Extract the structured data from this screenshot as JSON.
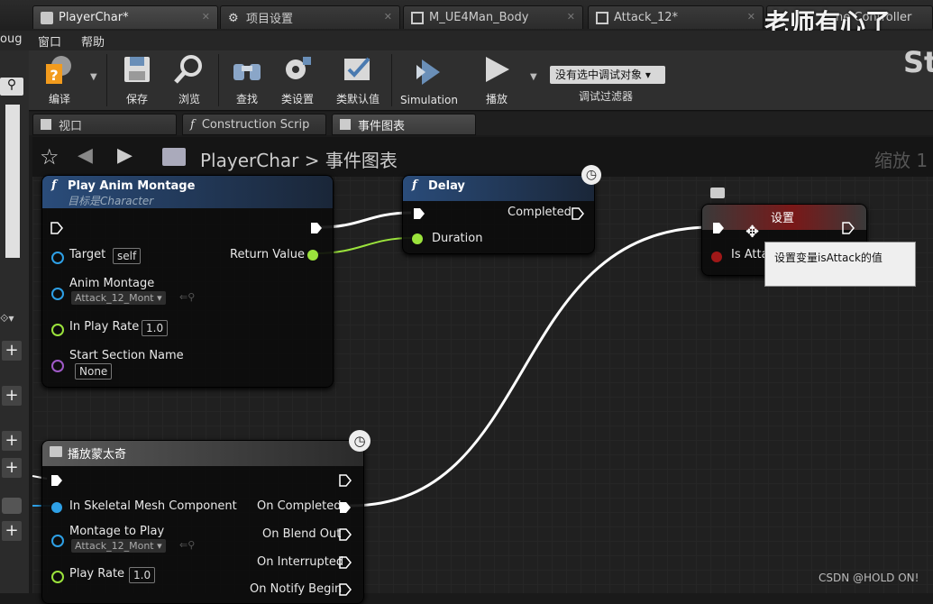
{
  "tabs": [
    {
      "label": "PlayerChar*",
      "active": true
    },
    {
      "label": "项目设置",
      "active": false
    },
    {
      "label": "M_UE4Man_Body",
      "active": false
    },
    {
      "label": "Attack_12*",
      "active": false
    },
    {
      "label": "ne Controller",
      "active": false
    }
  ],
  "watermark": "老师有心了",
  "menu": {
    "debug": "oug",
    "window": "窗口",
    "help": "帮助"
  },
  "toolbar": {
    "compile": "编译",
    "save": "保存",
    "browse": "浏览",
    "find": "查找",
    "class_settings": "类设置",
    "class_defaults": "类默认值",
    "simulation": "Simulation",
    "play": "播放",
    "debug_object": "没有选中调试对象",
    "debug_filter": "调试过滤器",
    "right_text": "St"
  },
  "subtabs": {
    "viewport": "视口",
    "construction": "Construction Scrip",
    "event_graph": "事件图表"
  },
  "breadcrumb": {
    "root": "PlayerChar",
    "sep": ">",
    "current": "事件图表",
    "zoom": "缩放 1"
  },
  "node_montage": {
    "title": "Play Anim Montage",
    "subtitle": "目标是Character",
    "target": "Target",
    "target_val": "self",
    "anim_montage": "Anim Montage",
    "anim_montage_val": "Attack_12_Mont",
    "in_play_rate": "In Play Rate",
    "in_play_rate_val": "1.0",
    "start_section": "Start Section Name",
    "start_section_val": "None",
    "return_value": "Return Value"
  },
  "node_delay": {
    "title": "Delay",
    "completed": "Completed",
    "duration": "Duration"
  },
  "node_set": {
    "title": "设置",
    "is_attack": "Is Atta",
    "tooltip": "设置变量isAttack的值"
  },
  "node_play": {
    "title": "播放蒙太奇",
    "in_skeletal": "In Skeletal Mesh Component",
    "montage_to_play": "Montage to Play",
    "montage_val": "Attack_12_Mont",
    "play_rate": "Play Rate",
    "play_rate_val": "1.0",
    "on_completed": "On Completed",
    "on_blend_out": "On Blend Out",
    "on_interrupted": "On Interrupted",
    "on_notify_begin": "On Notify Begin"
  },
  "credit": "CSDN @HOLD ON!",
  "colors": {
    "exec_white": "#ffffff",
    "float_green": "#9be33c",
    "object_blue": "#2ea0e6",
    "name_purple": "#a05ac8",
    "bool_red": "#a01818"
  }
}
